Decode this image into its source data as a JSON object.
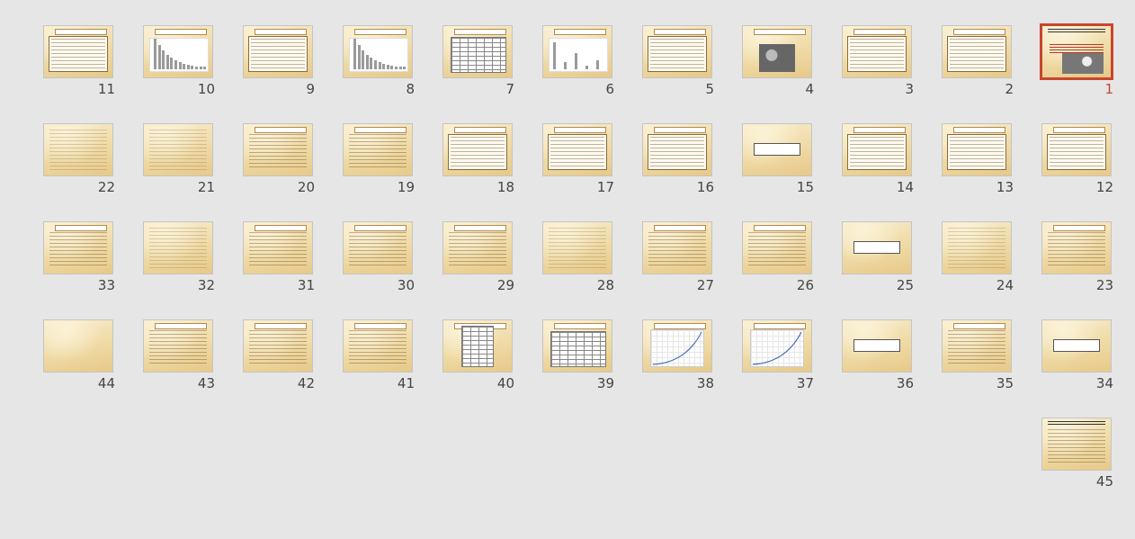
{
  "window": {
    "view": "Slide Sorter"
  },
  "slides": [
    {
      "number": "1",
      "type": "cover",
      "selected": true
    },
    {
      "number": "2",
      "type": "text-frame"
    },
    {
      "number": "3",
      "type": "text-frame"
    },
    {
      "number": "4",
      "type": "photos"
    },
    {
      "number": "5",
      "type": "text-frame"
    },
    {
      "number": "6",
      "type": "bar-chart"
    },
    {
      "number": "7",
      "type": "table"
    },
    {
      "number": "8",
      "type": "bar-chart-falling"
    },
    {
      "number": "9",
      "type": "text-frame"
    },
    {
      "number": "10",
      "type": "bar-chart-falling"
    },
    {
      "number": "11",
      "type": "text-frame"
    },
    {
      "number": "12",
      "type": "text-frame"
    },
    {
      "number": "13",
      "type": "text-frame"
    },
    {
      "number": "14",
      "type": "text-frame"
    },
    {
      "number": "15",
      "type": "centered-title"
    },
    {
      "number": "16",
      "type": "text-frame"
    },
    {
      "number": "17",
      "type": "text-frame"
    },
    {
      "number": "18",
      "type": "text-frame"
    },
    {
      "number": "19",
      "type": "text"
    },
    {
      "number": "20",
      "type": "text"
    },
    {
      "number": "21",
      "type": "text-plain"
    },
    {
      "number": "22",
      "type": "text-plain"
    },
    {
      "number": "23",
      "type": "text"
    },
    {
      "number": "24",
      "type": "text-plain"
    },
    {
      "number": "25",
      "type": "centered-title"
    },
    {
      "number": "26",
      "type": "text"
    },
    {
      "number": "27",
      "type": "text"
    },
    {
      "number": "28",
      "type": "text-plain"
    },
    {
      "number": "29",
      "type": "text"
    },
    {
      "number": "30",
      "type": "text"
    },
    {
      "number": "31",
      "type": "text"
    },
    {
      "number": "32",
      "type": "text-plain"
    },
    {
      "number": "33",
      "type": "text"
    },
    {
      "number": "34",
      "type": "centered-title"
    },
    {
      "number": "35",
      "type": "text"
    },
    {
      "number": "36",
      "type": "centered-title"
    },
    {
      "number": "37",
      "type": "curve-chart"
    },
    {
      "number": "38",
      "type": "curve-chart"
    },
    {
      "number": "39",
      "type": "table"
    },
    {
      "number": "40",
      "type": "table-narrow"
    },
    {
      "number": "41",
      "type": "text"
    },
    {
      "number": "42",
      "type": "text"
    },
    {
      "number": "43",
      "type": "text"
    },
    {
      "number": "44",
      "type": "blank"
    },
    {
      "number": "45",
      "type": "dense-text"
    }
  ]
}
